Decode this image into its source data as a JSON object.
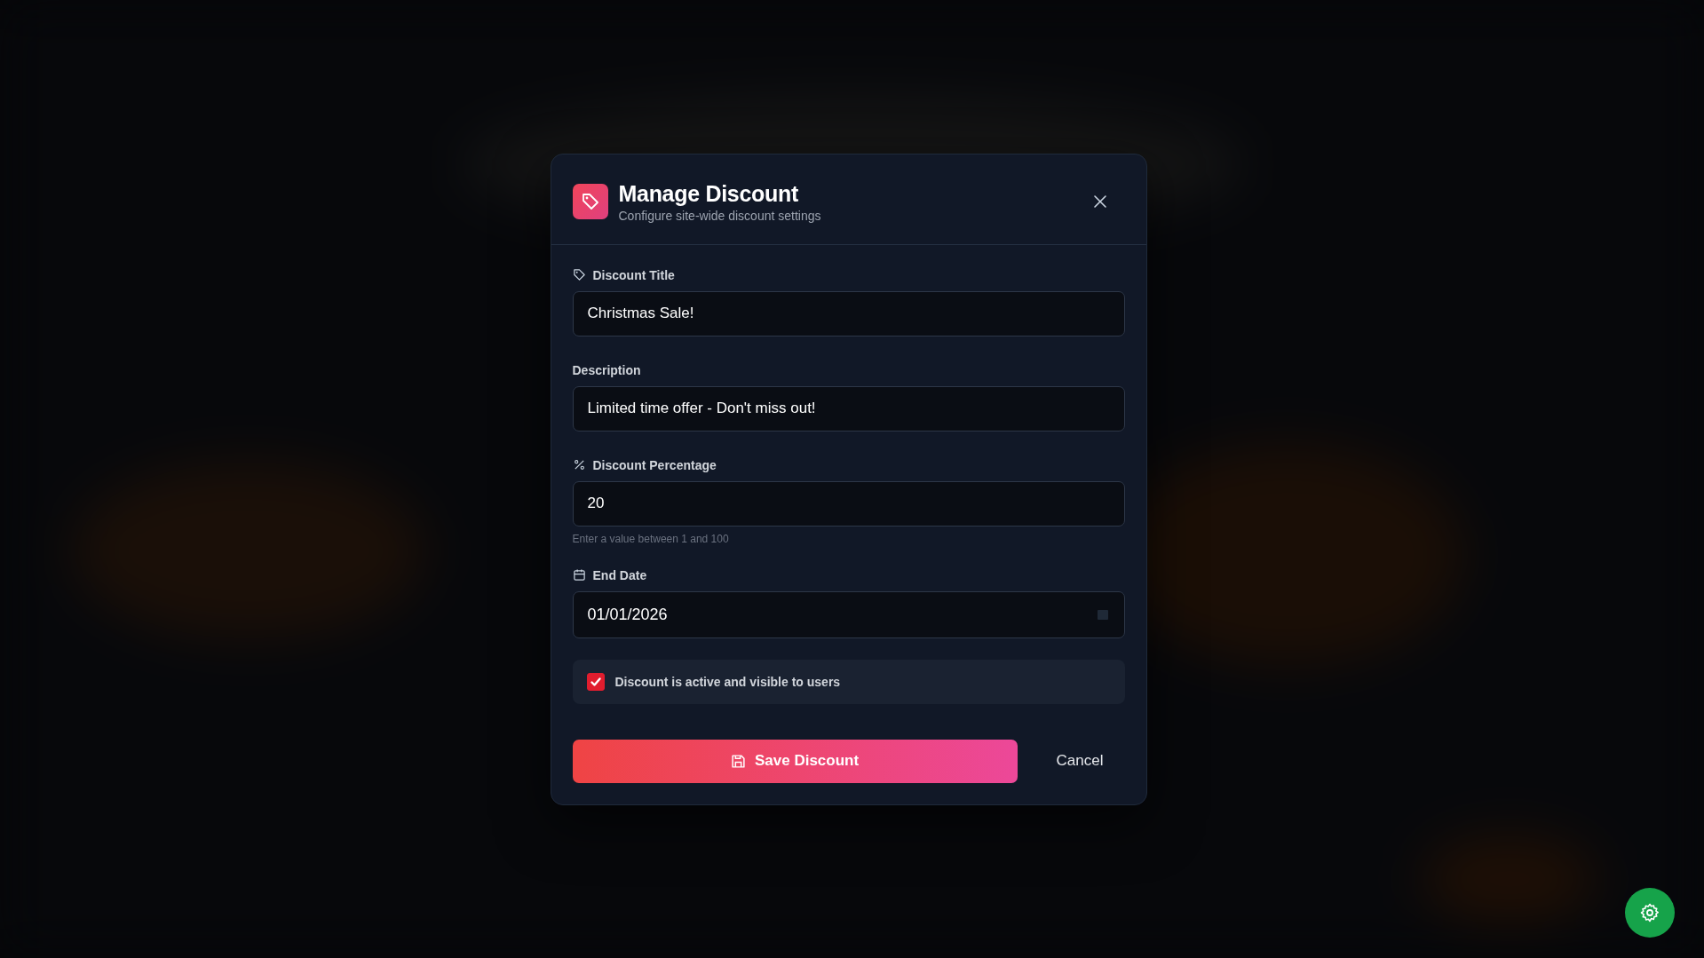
{
  "dialog": {
    "title": "Manage Discount",
    "subtitle": "Configure site-wide discount settings",
    "fields": [
      {
        "kind": "text",
        "label": "Discount Title",
        "value": "Christmas Sale!"
      },
      {
        "kind": "text",
        "label": "Description",
        "value": "Limited time offer - Don't miss out!"
      },
      {
        "kind": "number",
        "label": "Discount Percentage",
        "value": "20",
        "hint": "Enter a value between 1 and 100"
      },
      {
        "kind": "date",
        "label": "End Date",
        "value": "01/01/2026"
      }
    ],
    "active": {
      "label": "Discount is active and visible to users",
      "checked": true
    },
    "buttons": {
      "save": "Save Discount",
      "cancel": "Cancel"
    }
  }
}
